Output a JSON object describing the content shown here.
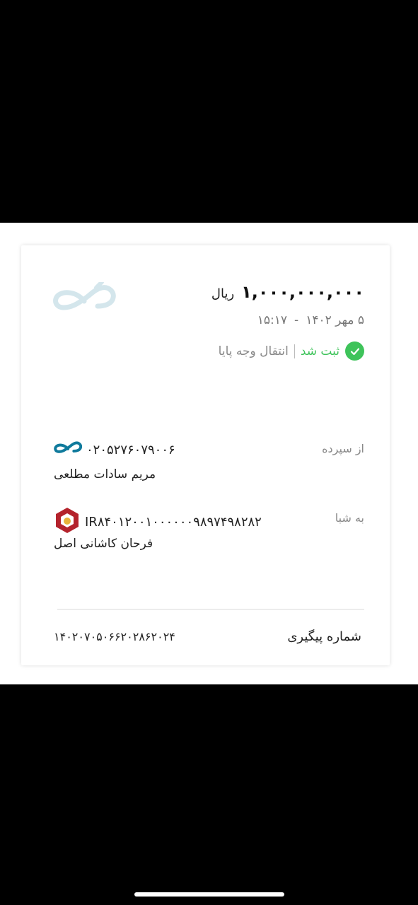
{
  "receipt": {
    "amount": "۱,۰۰۰,۰۰۰,۰۰۰",
    "currency": "ریال",
    "date": "۵ مهر ۱۴۰۲",
    "time": "۱۵:۱۷",
    "datetime_separator": "-",
    "status": "ثبت شد",
    "transaction_type": "انتقال وجه پایا",
    "from_label": "از سپرده",
    "from_account": "۰۲۰۵۲۷۶۰۷۹۰۰۶",
    "from_name": "مریم سادات مطلعی",
    "to_label": "به شبا",
    "to_iban": "IR۸۴۰۱۲۰۰۱۰۰۰۰۰۰۹۸۹۷۴۹۸۲۸۲",
    "to_name": "فرحان کاشانی اصل",
    "tracking_label": "شماره پیگیری",
    "tracking_number": "۱۴۰۲۰۷۰۵۰۶۶۲۰۲۸۶۲۰۲۴"
  },
  "colors": {
    "status_green": "#3ec35a",
    "logo_light": "#d4e6ec",
    "logo_teal": "#0f7a9c",
    "bank_red": "#b4232c"
  },
  "icons": {
    "bank_logo": "infinity-bank-logo-icon",
    "status": "check-circle-icon",
    "dest_bank": "melli-bank-logo-icon"
  }
}
